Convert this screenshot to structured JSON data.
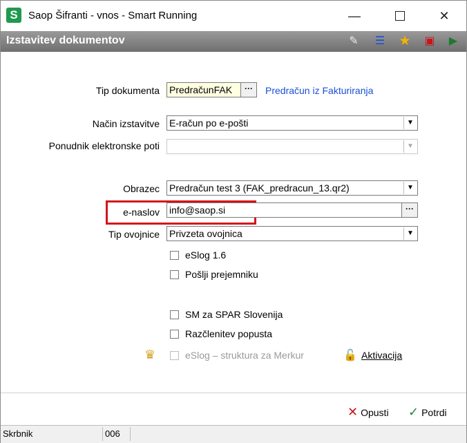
{
  "window": {
    "title": "Saop Šifranti - vnos - Smart Running",
    "app_icon": "S",
    "controls": {
      "minimize": "—",
      "maximize": "",
      "close": "✕"
    }
  },
  "header": {
    "title": "Izstavitev dokumentov",
    "icons": [
      "edit-icon",
      "list-icon",
      "favorite-star-icon",
      "delete-icon",
      "exit-icon"
    ]
  },
  "form": {
    "tip_dokumenta": {
      "label": "Tip dokumenta",
      "value": "PredračunFAK",
      "description": "Predračun iz Fakturiranja"
    },
    "nacin_izstavitve": {
      "label": "Način izstavitve",
      "value": "E-račun po e-pošti"
    },
    "ponudnik": {
      "label": "Ponudnik elektronske poti",
      "value": ""
    },
    "obrazec": {
      "label": "Obrazec",
      "value": "Predračun test 3 (FAK_predracun_13.qr2)"
    },
    "e_naslov": {
      "label": "e-naslov",
      "value": "info@saop.si"
    },
    "tip_ovojnice": {
      "label": "Tip ovojnice",
      "value": "Privzeta ovojnica"
    },
    "checkboxes": {
      "eslog": "eSlog 1.6",
      "poslji": "Pošlji prejemniku",
      "spar": "SM za SPAR Slovenija",
      "razclenitev": "Razčlenitev popusta",
      "merkur": "eSlog – struktura za Merkur"
    },
    "activation": "Aktivacija"
  },
  "buttons": {
    "cancel": "Opusti",
    "confirm": "Potrdi"
  },
  "statusbar": {
    "user": "Skrbnik",
    "code": "006"
  },
  "colors": {
    "highlight": "#d4141b",
    "link": "#1a4fd6",
    "header": "#7a7a7a"
  }
}
